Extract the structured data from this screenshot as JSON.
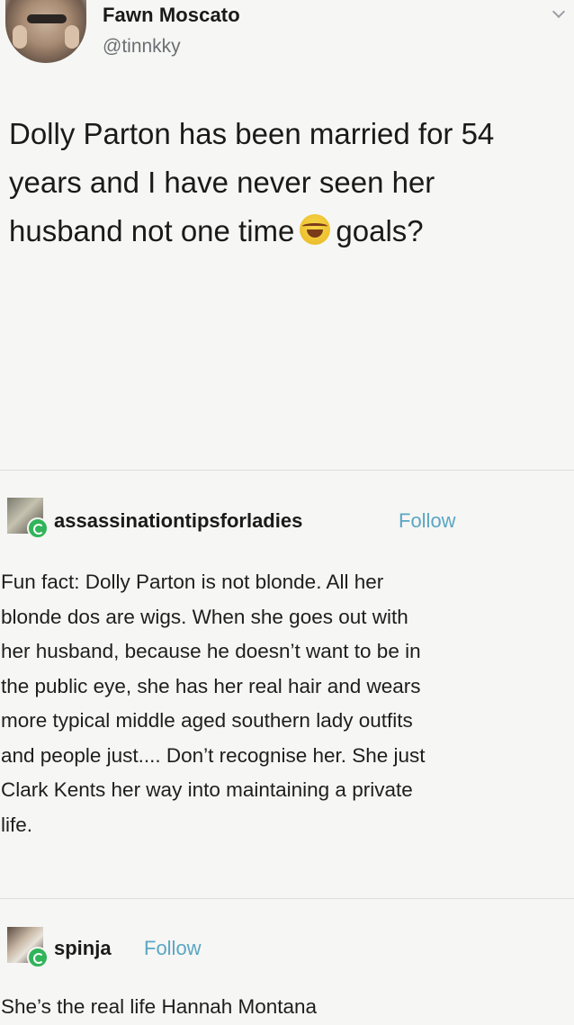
{
  "tweet": {
    "name": "Fawn Moscato",
    "handle": "@tinnkky",
    "lines": [
      "Dolly Parton has been married for 54",
      "years and I have never seen her",
      "husband not one time"
    ],
    "emoji": "face-with-tears-of-joy-emoji",
    "suffix": "goals?"
  },
  "posts": [
    {
      "username": "assassinationtipsforladies",
      "follow_label": "Follow",
      "lines": [
        "Fun fact: Dolly Parton is not blonde. All her",
        "blonde dos are wigs. When she goes out with",
        "her husband, because he doesn’t want to be in",
        "the public eye, she has her real hair and wears",
        "more typical middle aged southern lady outfits",
        "and people just.... Don’t recognise her. She just",
        "Clark Kents her way into maintaining a private",
        "life."
      ]
    },
    {
      "username": "spinja",
      "follow_label": "Follow",
      "lines": [
        "She’s the real life Hannah Montana"
      ]
    }
  ],
  "colors": {
    "background": "#f6f6f4",
    "follow_link": "#5aa6c4",
    "handle": "#6b6f73",
    "reblog_badge": "#32b45a"
  }
}
